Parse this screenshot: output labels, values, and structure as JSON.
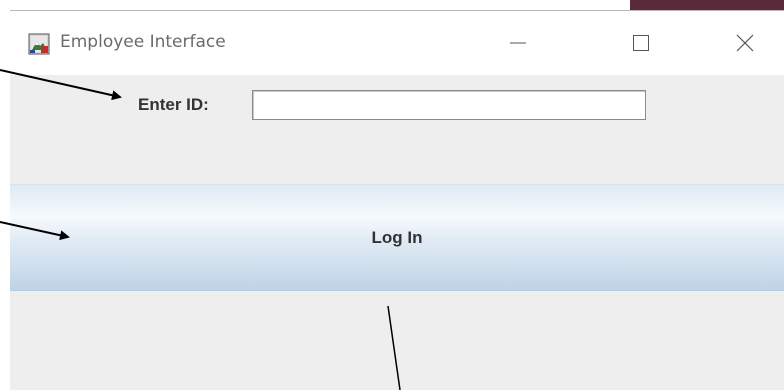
{
  "window": {
    "title": "Employee Interface",
    "controls": [
      "minimize",
      "maximize",
      "close"
    ],
    "app_icon": "java-app-icon"
  },
  "form": {
    "id_label": "Enter ID:",
    "id_value": "",
    "login_label": "Log In"
  },
  "colors": {
    "titlebar": "#ffffff",
    "content_background": "#eeeeee",
    "button_gradient_top": "#f7fafd",
    "button_gradient_bottom": "#bed3e7",
    "annotation_arrow": "#000000"
  }
}
